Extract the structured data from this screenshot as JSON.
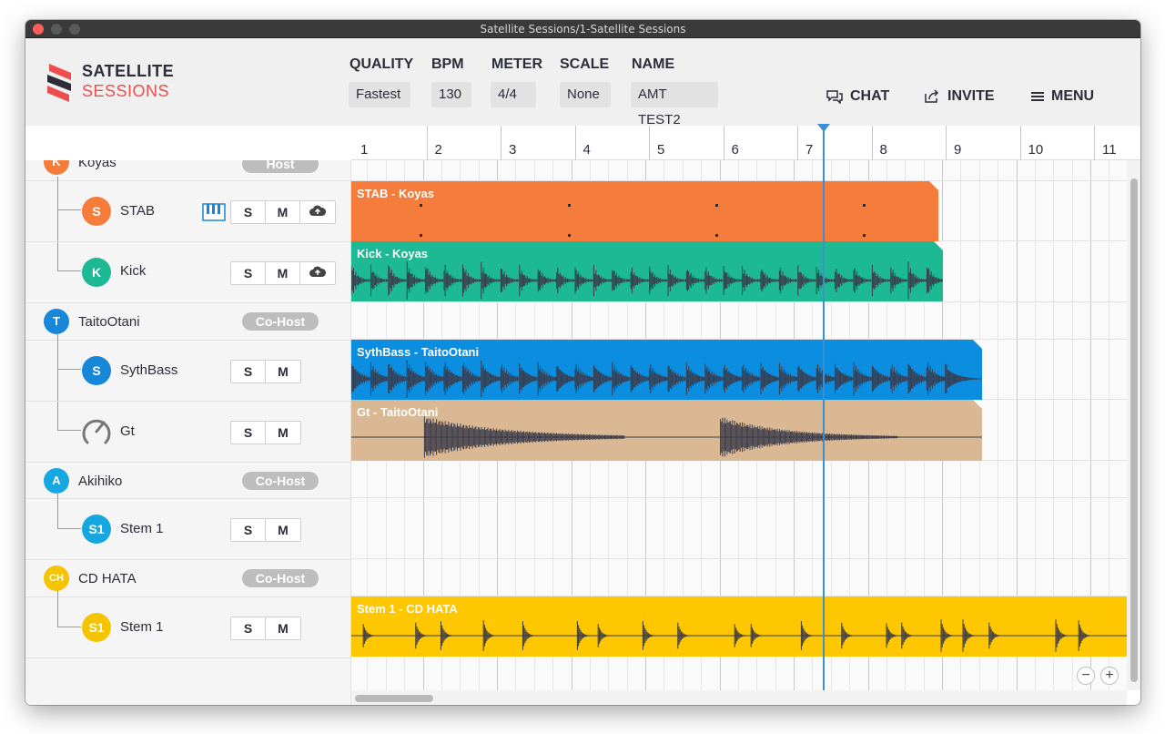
{
  "window": {
    "title": "Satellite Sessions/1-Satellite Sessions"
  },
  "logo": {
    "line1": "SATELLITE",
    "line2": "SESSIONS"
  },
  "settings": {
    "quality": {
      "label": "QUALITY",
      "value": "Fastest"
    },
    "bpm": {
      "label": "BPM",
      "value": "130"
    },
    "meter": {
      "label": "METER",
      "value": "4/4"
    },
    "scale": {
      "label": "SCALE",
      "value": "None"
    },
    "name": {
      "label": "NAME",
      "value": "AMT TEST2"
    }
  },
  "header_buttons": {
    "chat": "CHAT",
    "invite": "INVITE",
    "menu": "MENU"
  },
  "ruler": [
    "1",
    "2",
    "3",
    "4",
    "5",
    "6",
    "7",
    "8",
    "9",
    "10",
    "11"
  ],
  "rows": {
    "koyas": {
      "initial": "K",
      "name": "Koyas",
      "badge": "Host",
      "color": "#f57c3a"
    },
    "stab": {
      "initial": "S",
      "name": "STAB",
      "color": "#f57c3a",
      "s": "S",
      "m": "M"
    },
    "kick": {
      "initial": "K",
      "name": "Kick",
      "color": "#1db894",
      "s": "S",
      "m": "M"
    },
    "taito": {
      "initial": "T",
      "name": "TaitoOtani",
      "badge": "Co-Host",
      "color": "#1687d9"
    },
    "synth": {
      "initial": "S",
      "name": "SythBass",
      "color": "#1687d9",
      "s": "S",
      "m": "M"
    },
    "gt": {
      "name": "Gt",
      "s": "S",
      "m": "M"
    },
    "akihiko": {
      "initial": "A",
      "name": "Akihiko",
      "badge": "Co-Host",
      "color": "#16a6e0"
    },
    "akstem": {
      "initial": "S1",
      "name": "Stem 1",
      "color": "#16a6e0",
      "s": "S",
      "m": "M"
    },
    "cdhata": {
      "initial": "CH",
      "name": "CD HATA",
      "badge": "Co-Host",
      "color": "#f5c400"
    },
    "cdstem": {
      "initial": "S1",
      "name": "Stem 1",
      "color": "#f5c400",
      "s": "S",
      "m": "M"
    }
  },
  "clips": {
    "stab": {
      "title": "STAB - Koyas",
      "color": "#f57c3a"
    },
    "kick": {
      "title": "Kick - Koyas",
      "color": "#1db894"
    },
    "synth": {
      "title": "SythBass - TaitoOtani",
      "color": "#0c8ee0"
    },
    "gt": {
      "title": "Gt - TaitoOtani",
      "color": "#d9b893"
    },
    "stem": {
      "title": "Stem 1 - CD HATA",
      "color": "#fec700"
    }
  },
  "zoom": {
    "out": "−",
    "in": "+"
  }
}
